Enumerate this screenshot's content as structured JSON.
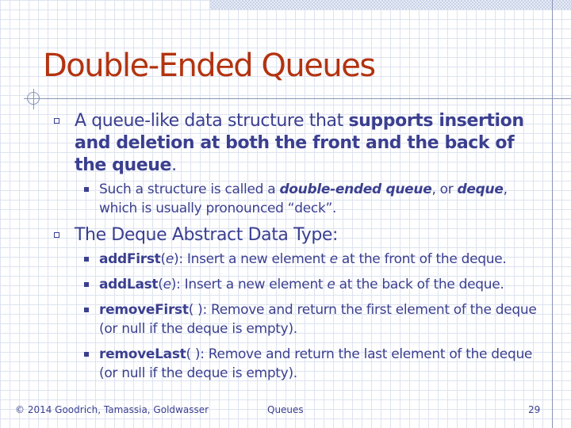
{
  "slide": {
    "title": "Double-Ended Queues",
    "bullets": [
      {
        "pre": "A queue-like data structure that ",
        "bold": "supports insertion and deletion at both the front and the back of the queue",
        "post": ".",
        "sub": [
          {
            "pre": "Such a structure is called a ",
            "em1": "double-ended queue",
            "mid": ", or ",
            "em2": "deque",
            "post": ", which is usually pronounced “deck”."
          }
        ]
      },
      {
        "text": "The Deque Abstract Data Type:",
        "sub": [
          {
            "name": "addFirst",
            "open": "(",
            "param": "e",
            "close": ")",
            "pre": ": Insert a new element ",
            "param2": "e",
            "post": " at the front of the deque."
          },
          {
            "name": "addLast",
            "open": "(",
            "param": "e",
            "close": ")",
            "pre": ": Insert a new element ",
            "param2": "e",
            "post": " at the back of the deque."
          },
          {
            "name": "removeFirst",
            "sig": "( )",
            "post": ": Remove and return the first element of the deque (or null if the deque is empty)."
          },
          {
            "name": "removeLast",
            "sig": "( )",
            "post": ": Remove and return the last element of the deque (or null if the deque is empty)."
          }
        ]
      }
    ]
  },
  "footer": {
    "copyright": "© 2014 Goodrich, Tamassia, Goldwasser",
    "topic": "Queues",
    "page": "29"
  },
  "colors": {
    "title": "#b33310",
    "text": "#3b3f8f",
    "grid": "#dde3f0"
  }
}
